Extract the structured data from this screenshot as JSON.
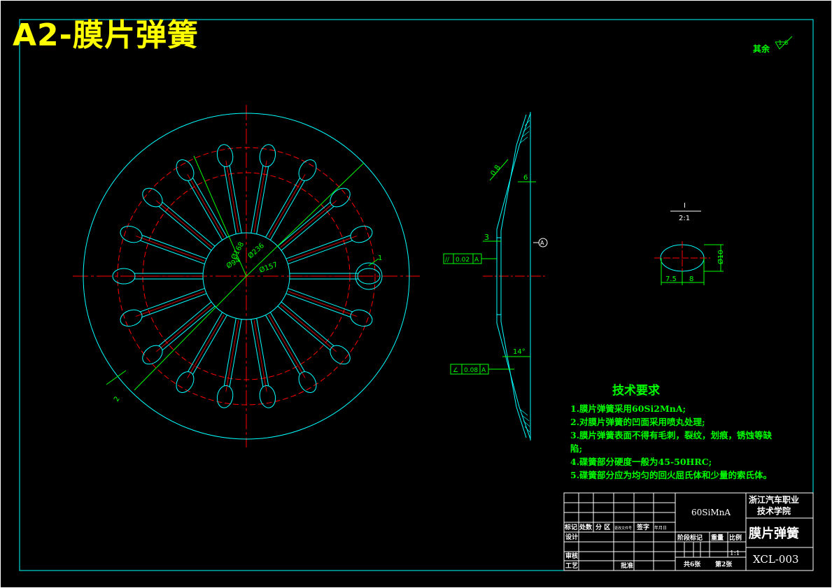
{
  "title": "A2-膜片弹簧",
  "surface_note": {
    "prefix": "其余",
    "roughness": "1.6"
  },
  "views": {
    "main": {
      "dims": [
        "Ø168",
        "Ø94",
        "Ø236",
        "Ø157"
      ],
      "detail_ref": "1",
      "section_mark": "2"
    },
    "section": {
      "dims": [
        "0.8",
        "6",
        "3",
        "14°"
      ],
      "datum": "A",
      "tolerances": [
        {
          "symbol": "//",
          "value": "0.02",
          "datum": "A"
        },
        {
          "symbol": "∠",
          "value": "0.08",
          "datum": "A"
        }
      ]
    },
    "detail": {
      "label": "I",
      "scale": "2:1",
      "dims": [
        "Ø10",
        "7.5",
        "8"
      ]
    }
  },
  "tech_requirements": {
    "heading": "技术要求",
    "items": [
      "1.膜片弹簧采用60Si2MnA;",
      "2.对膜片弹簧的凹面采用喷丸处理;",
      "3.膜片弹簧表面不得有毛刺，裂纹，划痕，锈蚀等缺",
      "陷;",
      "4.碟簧部分硬度一般为45-50HRC;",
      "5.碟簧部分应为均匀的回火屈氏体和少量的索氏体。"
    ]
  },
  "title_block": {
    "material": "60SiMnA",
    "school": [
      "浙江汽车职业",
      "技术学院"
    ],
    "part_name": "膜片弹簧",
    "drawing_no": "XCL-003",
    "col_headers": [
      "标记",
      "处数",
      "分 区",
      "更改文件号",
      "签字",
      "年月日"
    ],
    "design_row": {
      "label": "设计",
      "sign": "",
      "date": ""
    },
    "check": "审核",
    "process": "工艺",
    "approve": "批准",
    "stage_labels": [
      "阶段标记",
      "重量",
      "比例"
    ],
    "scale": "1:1",
    "sheets_total": "共6张",
    "sheet_no": "第2张"
  },
  "colors": {
    "border": "#00ffff",
    "outline": "#00ffff",
    "center_line": "#ff0000",
    "dimension": "#00ff00",
    "text": "#ffffff",
    "title": "#ffff00"
  }
}
